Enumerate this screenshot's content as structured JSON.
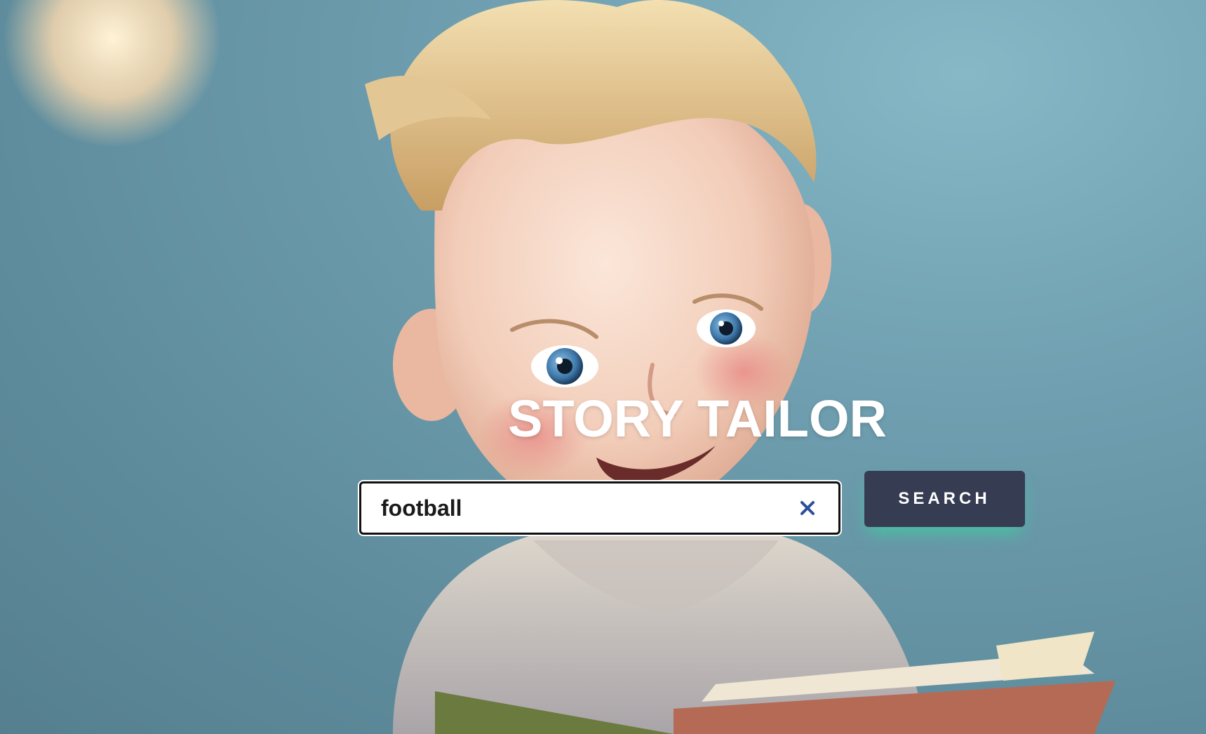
{
  "page": {
    "title": "STORY TAILOR",
    "background_image": "cartoon-boy-reading-book-illustration"
  },
  "search": {
    "value": "football",
    "clear_icon": "close-icon",
    "button_label": "SEARCH"
  },
  "colors": {
    "button_bg": "#363d52",
    "button_glow": "#3cd2a0",
    "clear_icon": "#2b4f9a",
    "title": "#ffffff"
  }
}
